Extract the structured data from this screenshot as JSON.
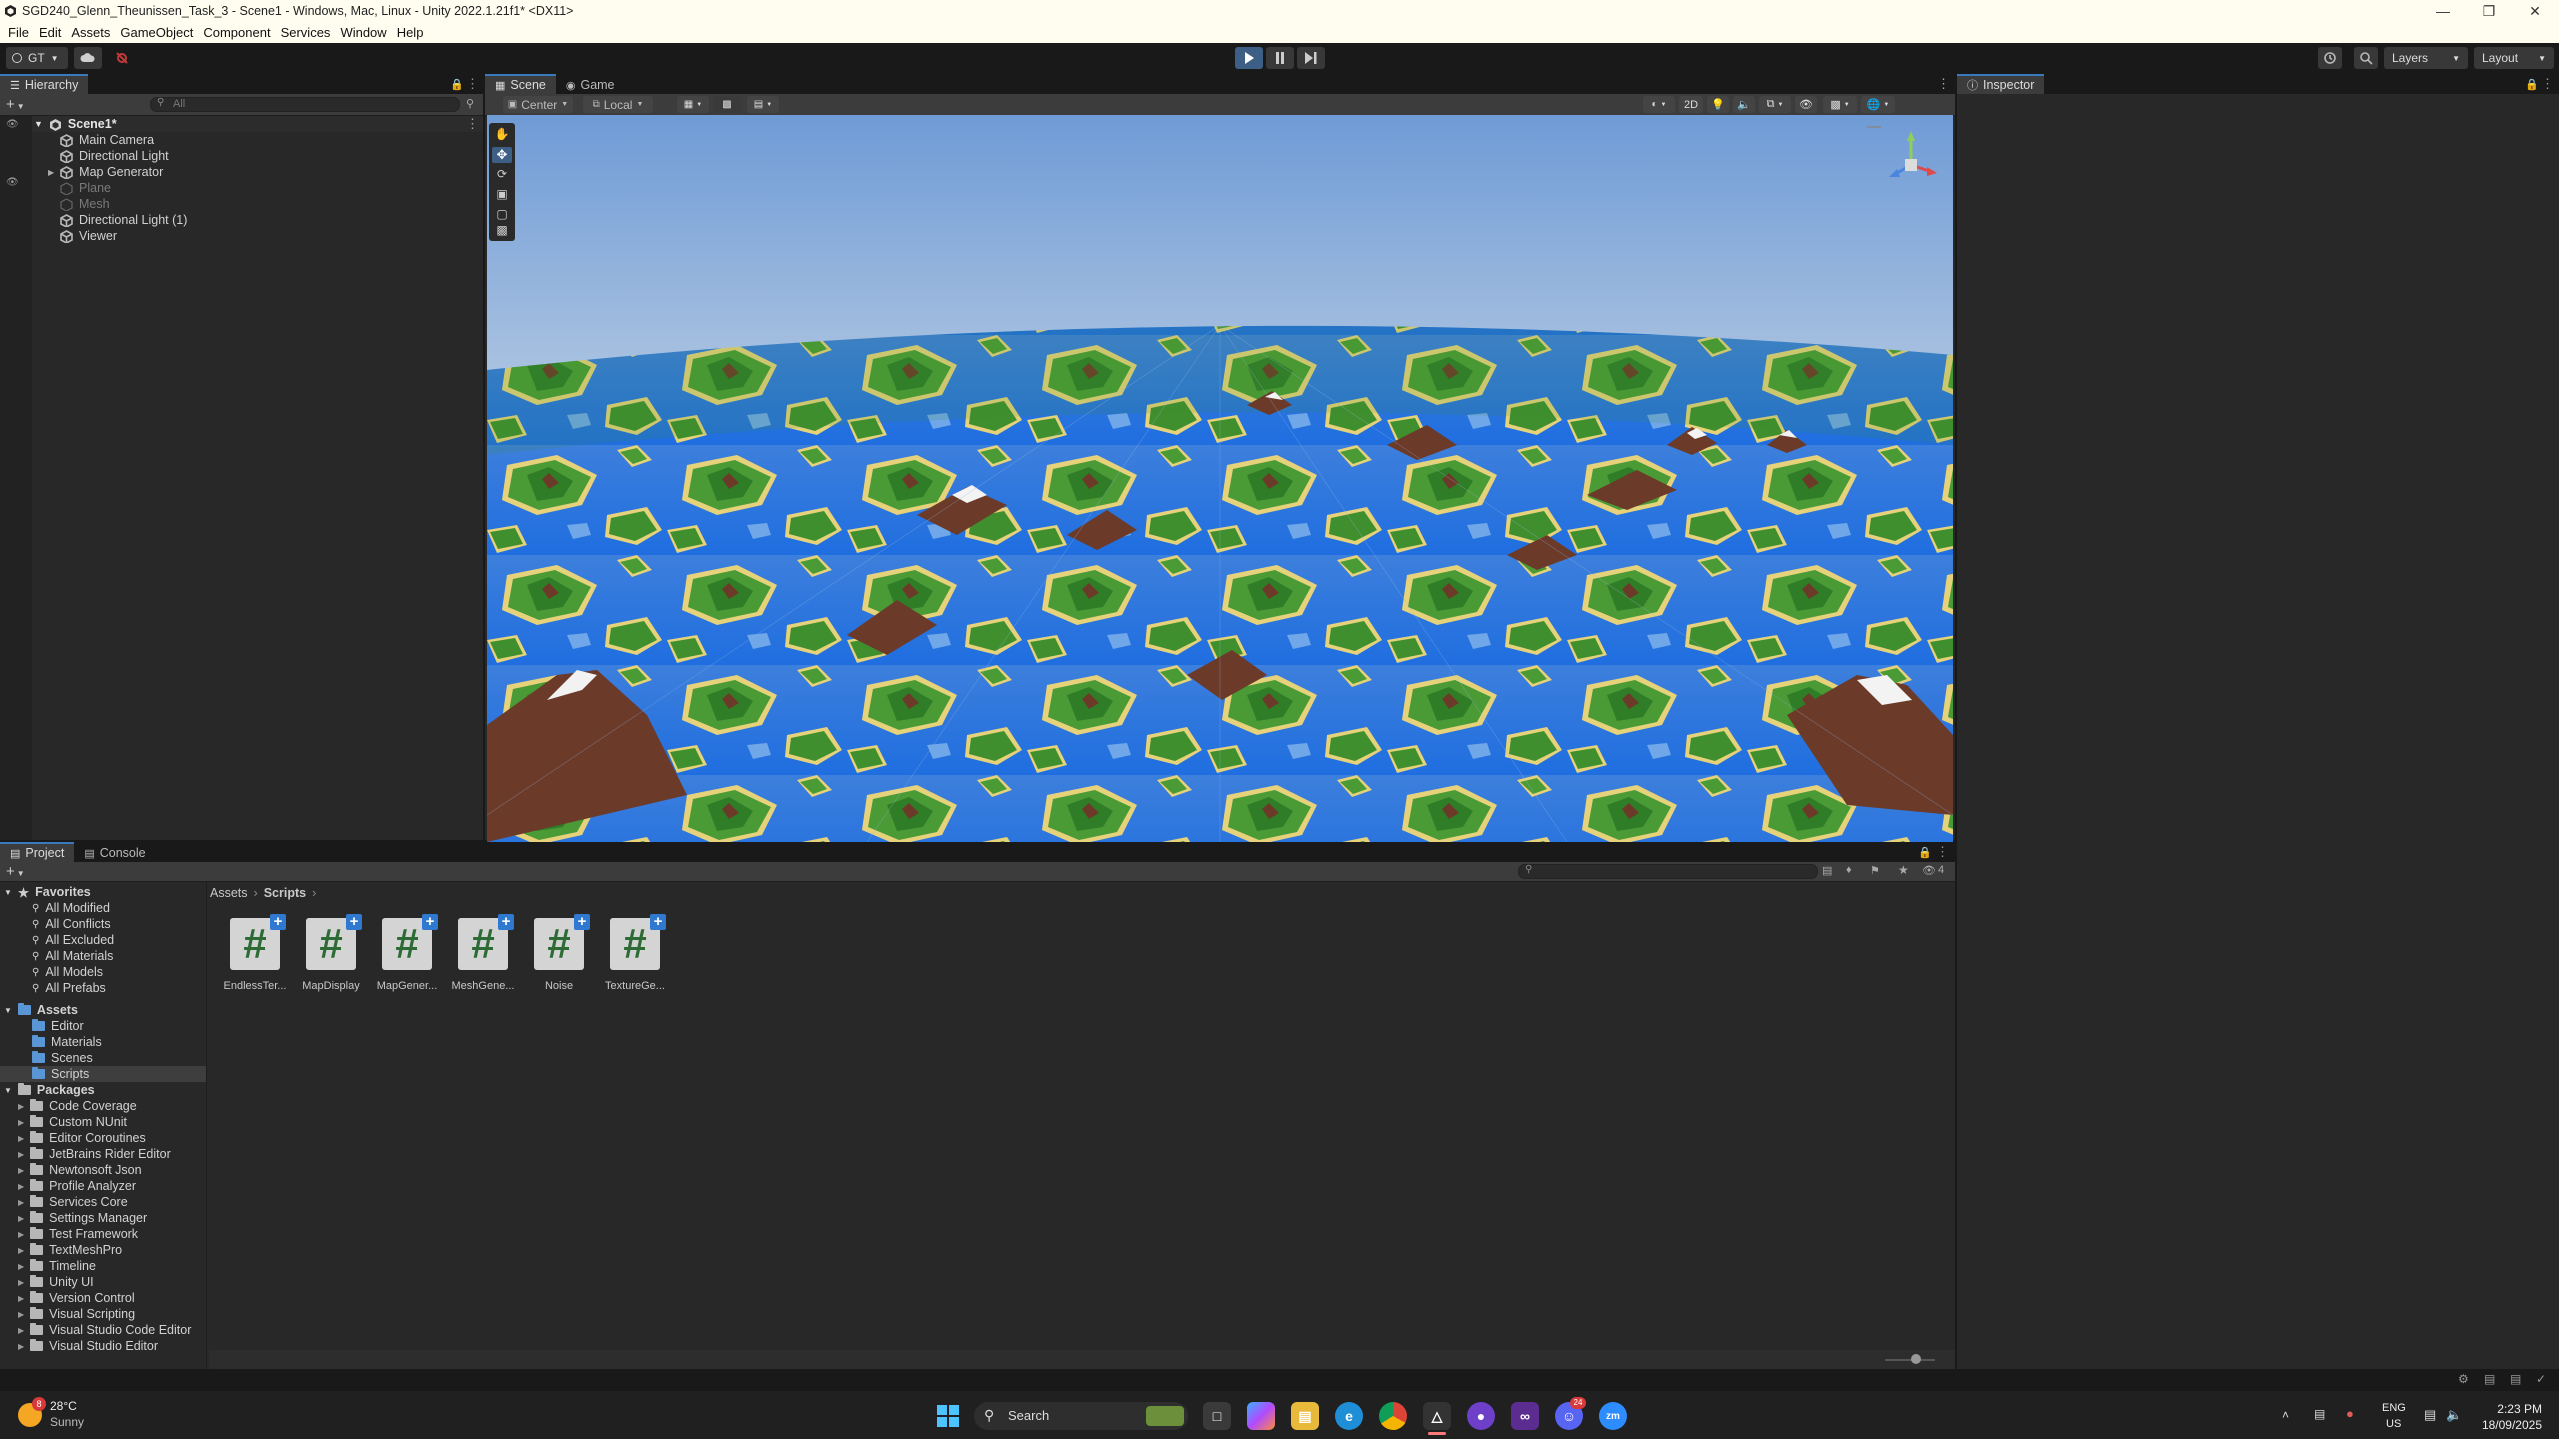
{
  "window": {
    "title": "SGD240_Glenn_Theunissen_Task_3 - Scene1 - Windows, Mac, Linux - Unity 2022.1.21f1* <DX11>"
  },
  "menu": [
    "File",
    "Edit",
    "Assets",
    "GameObject",
    "Component",
    "Services",
    "Window",
    "Help"
  ],
  "toolbar": {
    "account": "GT",
    "layers_label": "Layers",
    "layout_label": "Layout"
  },
  "hierarchy": {
    "tab": "Hierarchy",
    "search_placeholder": "All",
    "scene": "Scene1*",
    "items": [
      {
        "label": "Main Camera",
        "disabled": false
      },
      {
        "label": "Directional Light",
        "disabled": false
      },
      {
        "label": "Map Generator",
        "disabled": false
      },
      {
        "label": "Plane",
        "disabled": true
      },
      {
        "label": "Mesh",
        "disabled": true
      },
      {
        "label": "Directional Light (1)",
        "disabled": false
      },
      {
        "label": "Viewer",
        "disabled": false
      }
    ]
  },
  "scene_view": {
    "tabs": [
      "Scene",
      "Game"
    ],
    "pivot_label": "Center",
    "space_label": "Local",
    "mode_2d": "2D"
  },
  "inspector": {
    "tab": "Inspector"
  },
  "project": {
    "tabs": [
      "Project",
      "Console"
    ],
    "favorites_label": "Favorites",
    "favorites": [
      "All Modified",
      "All Conflicts",
      "All Excluded",
      "All Materials",
      "All Models",
      "All Prefabs"
    ],
    "assets_label": "Assets",
    "assets": [
      "Editor",
      "Materials",
      "Scenes",
      "Scripts"
    ],
    "packages_label": "Packages",
    "packages": [
      "Code Coverage",
      "Custom NUnit",
      "Editor Coroutines",
      "JetBrains Rider Editor",
      "Newtonsoft Json",
      "Profile Analyzer",
      "Services Core",
      "Settings Manager",
      "Test Framework",
      "TextMeshPro",
      "Timeline",
      "Unity UI",
      "Version Control",
      "Visual Scripting",
      "Visual Studio Code Editor",
      "Visual Studio Editor"
    ],
    "breadcrumb": [
      "Assets",
      "Scripts"
    ],
    "hidden_count": "4",
    "scripts": [
      "EndlessTer...",
      "MapDisplay",
      "MapGener...",
      "MeshGene...",
      "Noise",
      "TextureGe..."
    ]
  },
  "taskbar": {
    "weather_temp": "28°C",
    "weather_desc": "Sunny",
    "weather_badge": "8",
    "search_label": "Search",
    "lang_top": "ENG",
    "lang_bottom": "US",
    "time": "2:23 PM",
    "date": "18/09/2025",
    "discord_badge": "24"
  },
  "colors": {
    "accent": "#3a79bb",
    "panel": "#282828",
    "background": "#191919",
    "water": "#2b75e0",
    "grass": "#3f8f2e",
    "sand": "#e2cf70",
    "mountain": "#6e3b2a"
  }
}
